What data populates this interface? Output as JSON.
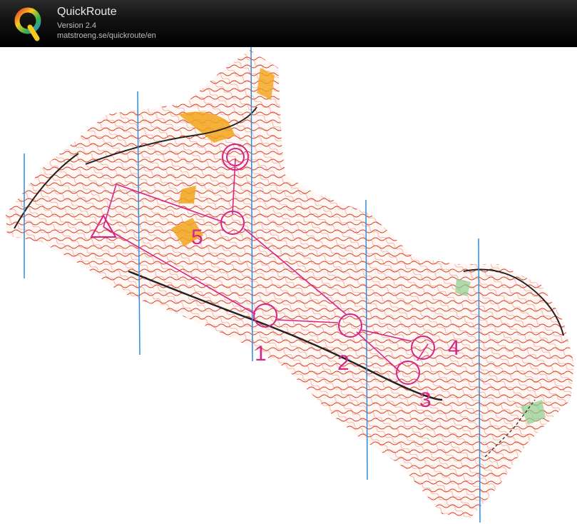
{
  "app": {
    "title": "QuickRoute",
    "version": "Version 2.4",
    "url": "matstroeng.se/quickroute/en"
  },
  "map": {
    "course_color": "#d6258a",
    "contour_color": "#d9432b",
    "meridian_color": "#2f8ddc",
    "vegetation_color": "#f1a41a",
    "controls": [
      {
        "id": "start",
        "label": ""
      },
      {
        "id": "c1",
        "label": "1"
      },
      {
        "id": "c2",
        "label": "2"
      },
      {
        "id": "c3",
        "label": "3"
      },
      {
        "id": "c4",
        "label": "4"
      },
      {
        "id": "c5",
        "label": "5"
      },
      {
        "id": "finish",
        "label": ""
      }
    ]
  }
}
